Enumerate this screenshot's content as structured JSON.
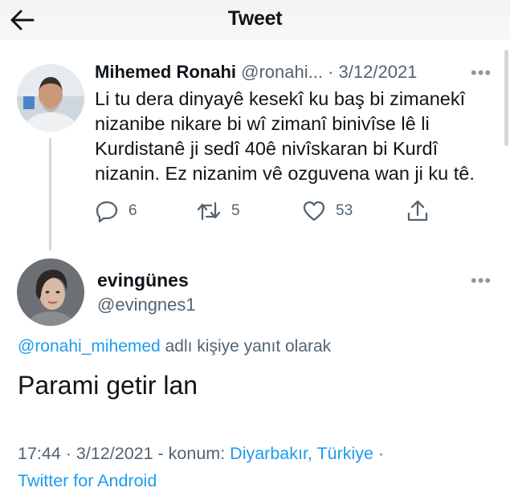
{
  "header": {
    "title": "Tweet",
    "back_icon": "arrow-left-icon"
  },
  "parent_tweet": {
    "author_name": "Mihemed Ronahi",
    "handle": "@ronahi...",
    "separator": "·",
    "date": "3/12/2021",
    "text": "Li tu dera dinyayê kesekî ku baş bi zimanekî nizanibe nikare bi wî zimanî binivîse lê li Kurdistanê ji sedî 40ê nivîskaran bi Kurdî nizanin. Ez nizanim vê ozguvena wan ji ku tê.",
    "replies": "6",
    "retweets": "5",
    "likes": "53"
  },
  "reply_tweet": {
    "author_name": "evingünes",
    "handle": "@evingnes1",
    "replying_mention": "@ronahi_mihemed",
    "replying_suffix": " adlı kişiye yanıt olarak",
    "text": "Parami getir lan",
    "time": "17:44",
    "dot": " · ",
    "date": "3/12/2021",
    "location_prefix": " - konum: ",
    "location": "Diyarbakır, Türkiye",
    "source": "Twitter for Android"
  },
  "colors": {
    "text": "#0f1419",
    "secondary": "#536471",
    "accent": "#1d9bf0",
    "thread_line": "#cfd9de"
  }
}
